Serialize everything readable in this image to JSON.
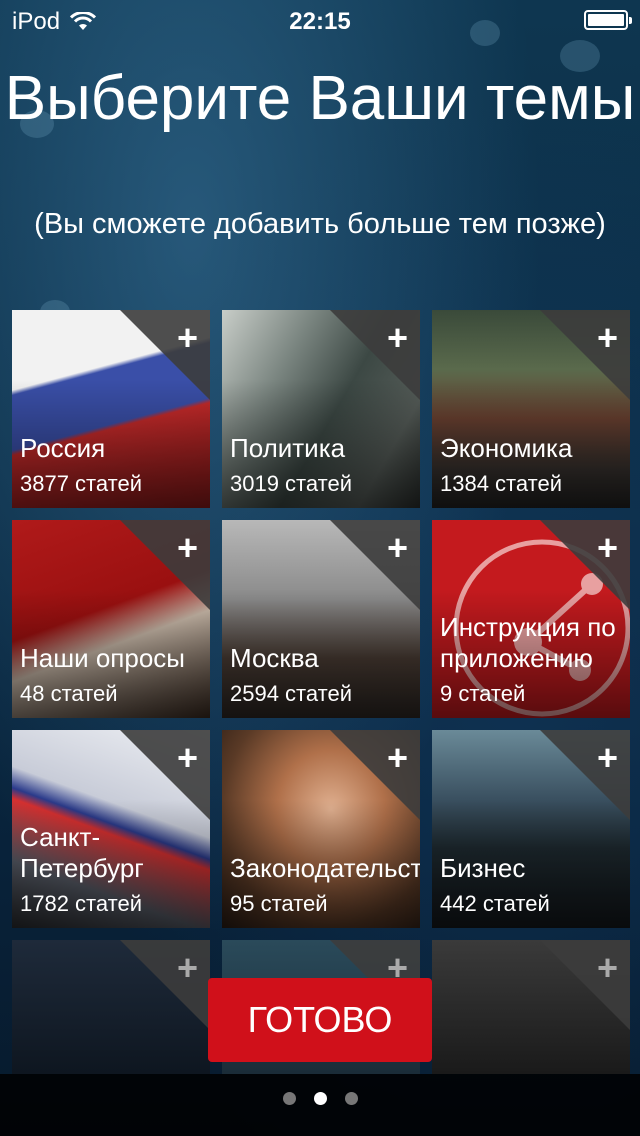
{
  "status": {
    "device": "iPod",
    "time": "22:15"
  },
  "header": {
    "title": "Выберите Ваши темы",
    "subtitle": "(Вы сможете добавить больше тем позже)"
  },
  "plus_symbol": "+",
  "tiles": [
    {
      "name": "Россия",
      "count": "3877 статей"
    },
    {
      "name": "Политика",
      "count": "3019 статей"
    },
    {
      "name": "Экономика",
      "count": "1384 статей"
    },
    {
      "name": "Наши опросы",
      "count": "48 статей"
    },
    {
      "name": "Москва",
      "count": "2594 статей"
    },
    {
      "name": "Инструкция по приложению",
      "count": "9 статей"
    },
    {
      "name": "Санкт-Петербург",
      "count": "1782 статей"
    },
    {
      "name": "Законодательство",
      "count": "95 статей"
    },
    {
      "name": "Бизнес",
      "count": "442 статей"
    }
  ],
  "done_label": "ГОТОВО",
  "pager": {
    "pages": 3,
    "active": 2
  },
  "colors": {
    "accent": "#d0101a"
  }
}
